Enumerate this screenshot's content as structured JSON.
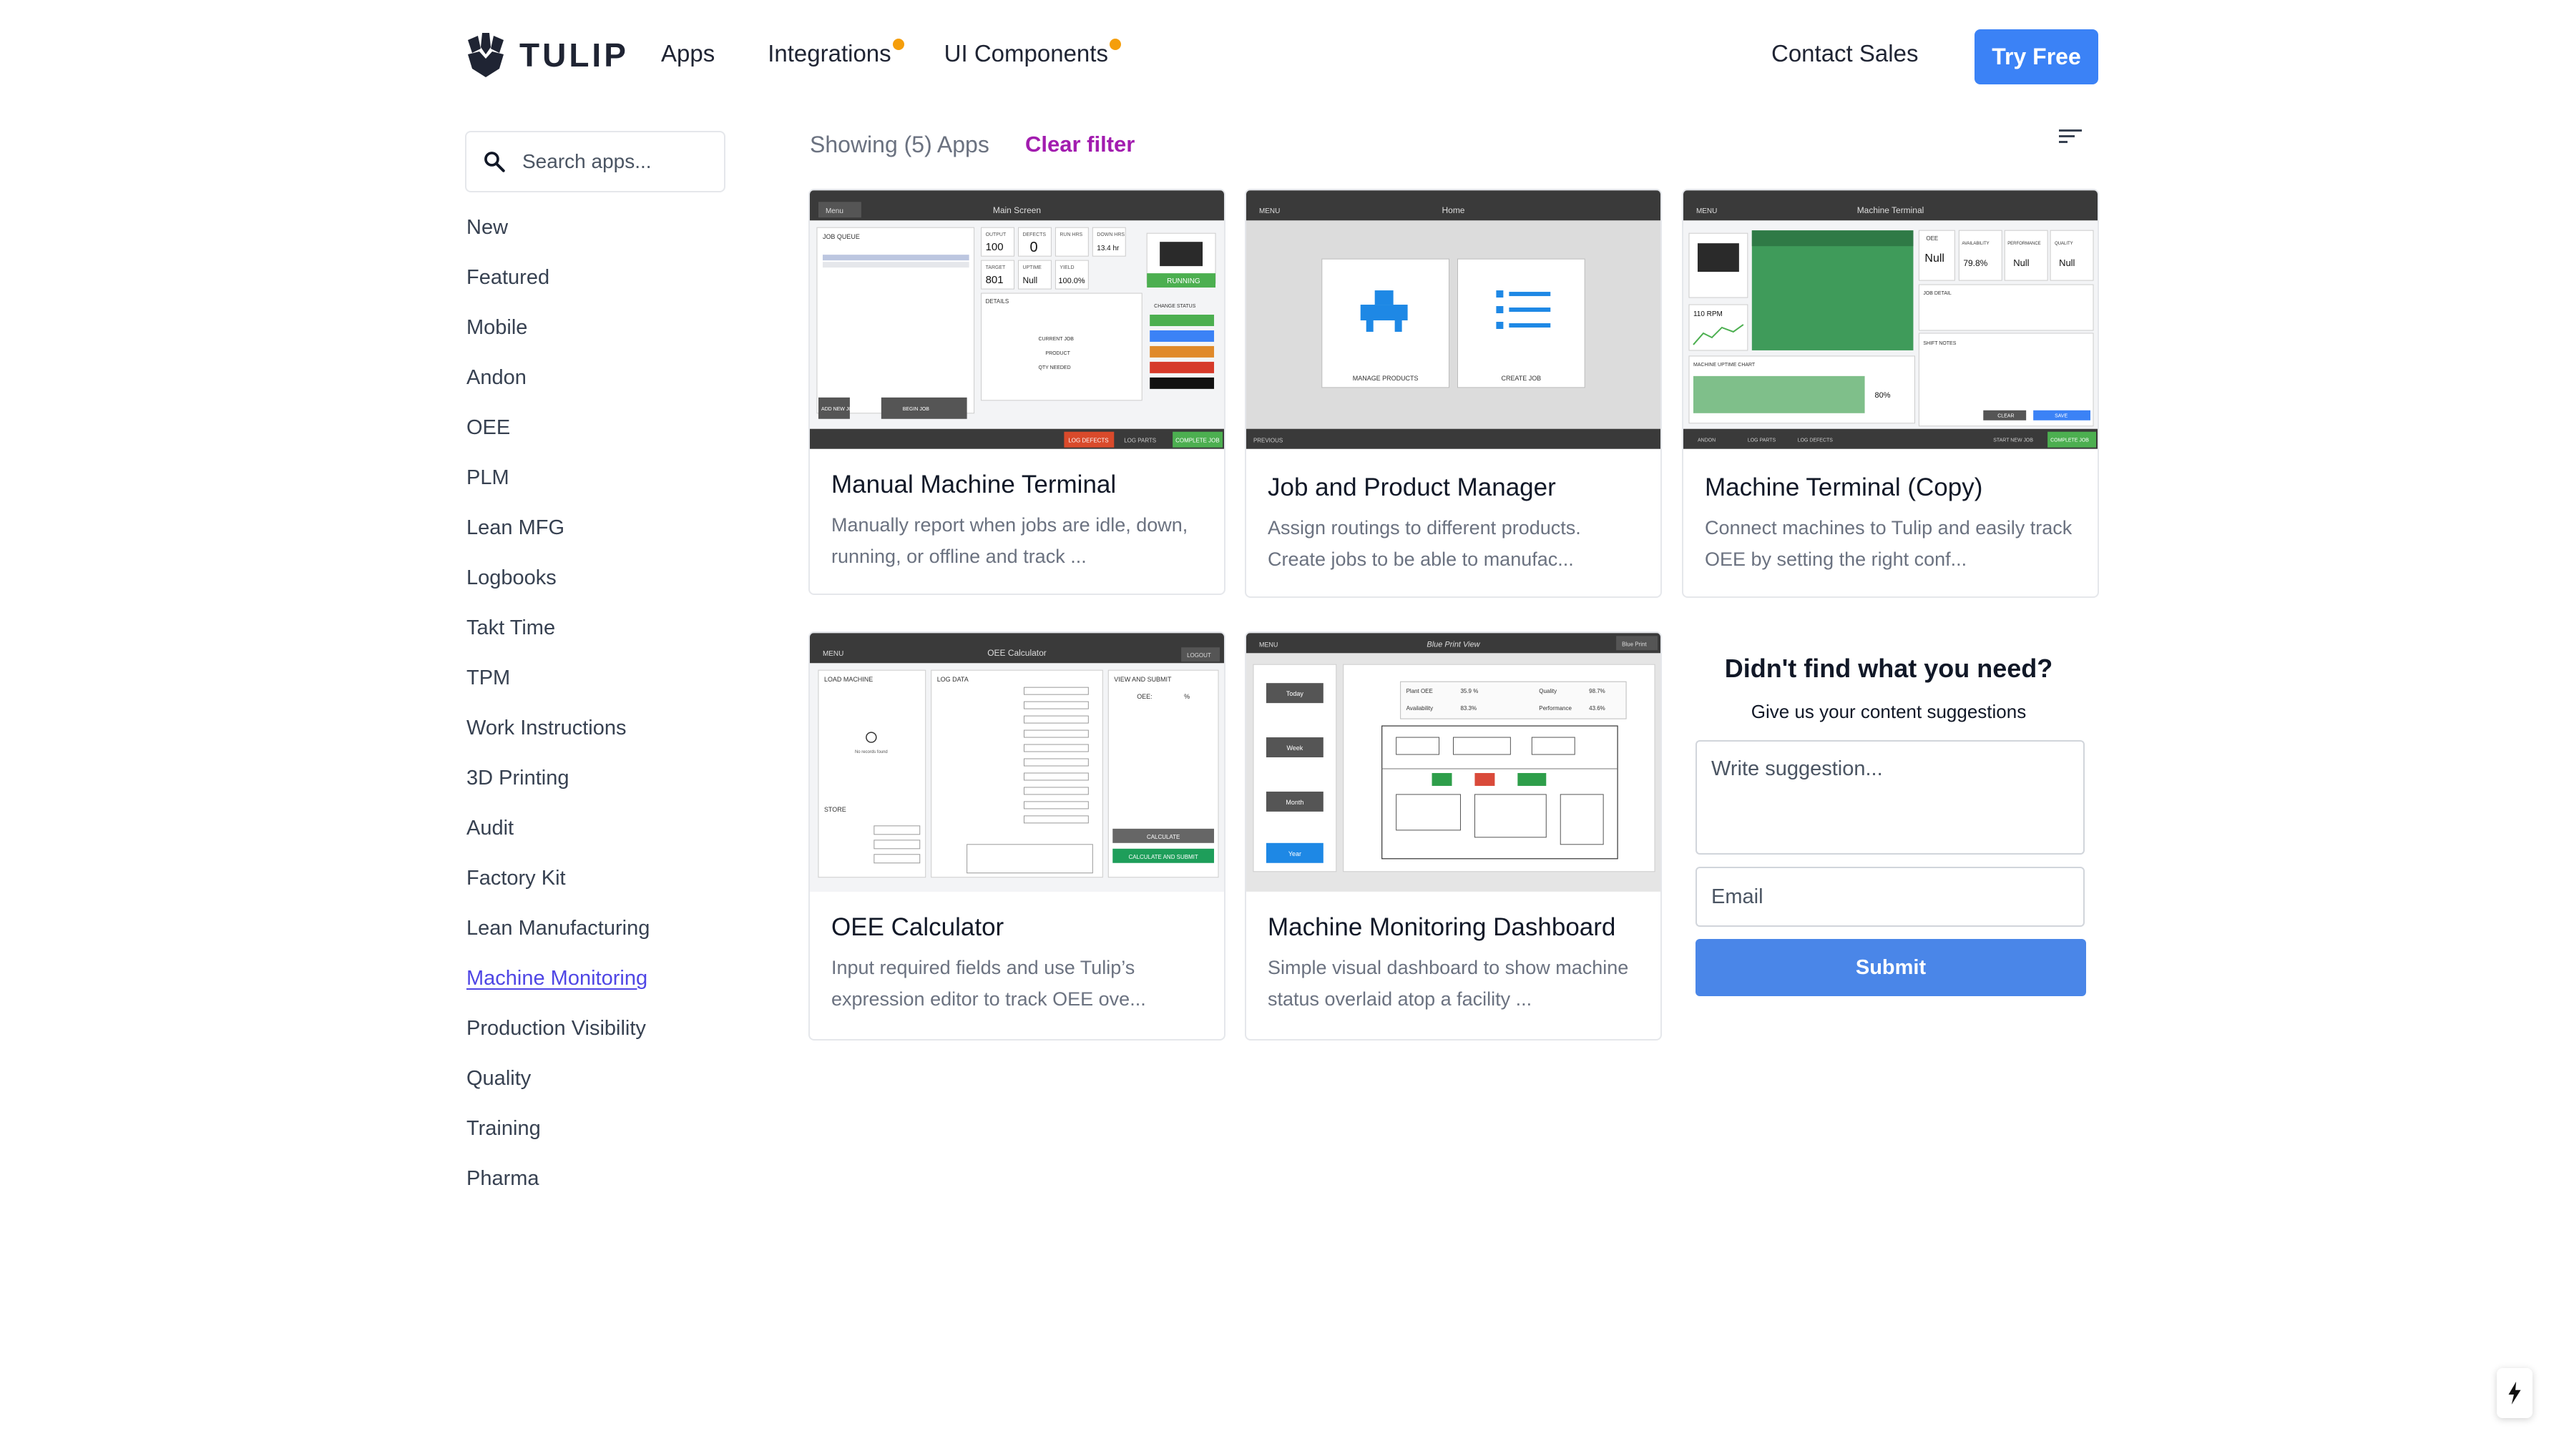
{
  "header": {
    "logo_text": "TULIP",
    "nav": [
      {
        "label": "Apps",
        "dot": false
      },
      {
        "label": "Integrations",
        "dot": true
      },
      {
        "label": "UI Components",
        "dot": true
      }
    ],
    "contact_label": "Contact Sales",
    "try_label": "Try Free",
    "accent_color": "#3b82f6",
    "dot_color": "#f59e0b"
  },
  "search": {
    "placeholder": "Search apps...",
    "icon": "search-icon"
  },
  "sidebar": {
    "items": [
      {
        "label": "New"
      },
      {
        "label": "Featured"
      },
      {
        "label": "Mobile"
      },
      {
        "label": "Andon"
      },
      {
        "label": "OEE"
      },
      {
        "label": "PLM"
      },
      {
        "label": "Lean MFG"
      },
      {
        "label": "Logbooks"
      },
      {
        "label": "Takt Time"
      },
      {
        "label": "TPM"
      },
      {
        "label": "Work Instructions"
      },
      {
        "label": "3D Printing"
      },
      {
        "label": "Audit"
      },
      {
        "label": "Factory Kit"
      },
      {
        "label": "Lean Manufacturing"
      },
      {
        "label": "Machine Monitoring",
        "active": true
      },
      {
        "label": "Production Visibility"
      },
      {
        "label": "Quality"
      },
      {
        "label": "Training"
      },
      {
        "label": "Pharma"
      }
    ],
    "active_color": "#4f46e5"
  },
  "toolbar": {
    "showing_text": "Showing (5) Apps",
    "clear_label": "Clear filter",
    "sort_icon": "sort-icon"
  },
  "cards": [
    {
      "title": "Manual Machine Terminal",
      "desc": "Manually report when jobs are idle, down, running, or offline and track ...",
      "thumb": {
        "header_title": "Main Screen",
        "menu": "Menu",
        "queue": "JOB QUEUE",
        "output": "OUTPUT",
        "output_val": "100",
        "defects": "DEFECTS",
        "defects_val": "0",
        "run_hrs": "RUN HRS",
        "down_hrs": "DOWN HRS",
        "down_val": "13.4 hr",
        "target": "TARGET",
        "target_val": "801",
        "uptime": "UPTIME",
        "uptime_val": "Null",
        "yield": "YIELD",
        "yield_val": "100.0%",
        "running": "RUNNING",
        "change_status": "CHANGE STATUS",
        "details": "DETAILS",
        "current_job": "CURRENT JOB",
        "product": "PRODUCT",
        "qty": "QTY NEEDED",
        "add_new": "ADD NEW JOB",
        "begin": "BEGIN JOB",
        "log_defects": "LOG DEFECTS",
        "log_parts": "LOG PARTS",
        "complete": "COMPLETE JOB"
      }
    },
    {
      "title": "Job and Product Manager",
      "desc": "Assign routings to different products. Create jobs to be able to manufac...",
      "thumb": {
        "header_title": "Home",
        "menu": "MENU",
        "tile1": "MANAGE PRODUCTS",
        "tile2": "CREATE JOB",
        "prev": "PREVIOUS"
      }
    },
    {
      "title": "Machine Terminal (Copy)",
      "desc": "Connect machines to Tulip and easily track OEE by setting the right conf...",
      "thumb": {
        "header_title": "Machine Terminal",
        "menu": "MENU",
        "oee": "OEE",
        "oee_val": "Null",
        "avail": "AVAILABILITY",
        "avail_val": "79.8%",
        "perf": "PERFORMANCE",
        "perf_val": "Null",
        "qual": "QUALITY",
        "qual_val": "Null",
        "rpm": "110 RPM",
        "chart": "MACHINE UPTIME CHART",
        "pct": "80%",
        "job_detail": "JOB DETAIL",
        "shift_notes": "SHIFT NOTES",
        "clear": "CLEAR",
        "save": "SAVE",
        "andon": "ANDON",
        "log_parts": "LOG PARTS",
        "log_defects": "LOG DEFECTS",
        "start_new": "START NEW JOB",
        "complete": "COMPLETE JOB"
      }
    },
    {
      "title": "OEE Calculator",
      "desc": "Input required fields and use Tulip’s expression editor to track OEE ove...",
      "thumb": {
        "header_title": "OEE Calculator",
        "menu": "MENU",
        "logout": "LOGOUT",
        "load": "LOAD MACHINE",
        "log": "LOG DATA",
        "view": "VIEW AND SUBMIT",
        "oee": "OEE:",
        "pct": "%",
        "store": "STORE",
        "calc": "CALCULATE",
        "calc_submit": "CALCULATE AND SUBMIT",
        "no_records": "No records found"
      }
    },
    {
      "title": "Machine Monitoring Dashboard",
      "desc": "Simple visual dashboard to show machine status overlaid atop a facility ...",
      "thumb": {
        "header_title": "Blue Print View",
        "menu": "MENU",
        "blue_print": "Blue Print",
        "today": "Today",
        "week": "Week",
        "month": "Month",
        "year": "Year",
        "plant_oee": "Plant OEE",
        "plant_oee_val": "35.9 %",
        "quality": "Quality",
        "quality_val": "98.7%",
        "avail": "Availability",
        "avail_val": "83.3%",
        "perf": "Performance",
        "perf_val": "43.6%"
      }
    }
  ],
  "suggestion": {
    "title": "Didn't find what you need?",
    "subtitle": "Give us your content suggestions",
    "text_placeholder": "Write suggestion...",
    "email_placeholder": "Email",
    "submit_label": "Submit",
    "submit_color": "#4a86e8"
  }
}
